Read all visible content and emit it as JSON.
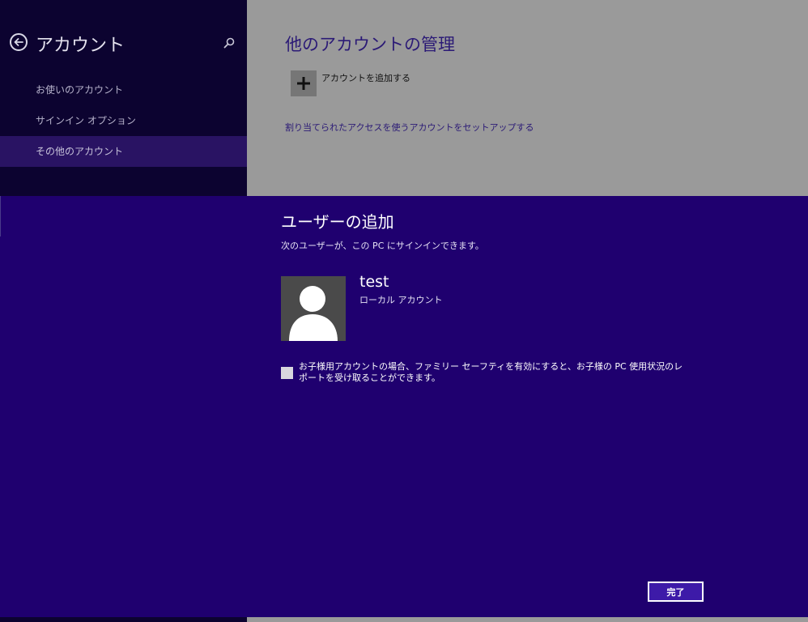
{
  "nav": {
    "title": "アカウント",
    "items": [
      {
        "label": "お使いのアカウント",
        "active": false
      },
      {
        "label": "サインイン オプション",
        "active": false
      },
      {
        "label": "その他のアカウント",
        "active": true
      }
    ]
  },
  "content": {
    "title": "他のアカウントの管理",
    "add_account_label": "アカウントを追加する",
    "assigned_access_link": "割り当てられたアクセスを使うアカウントをセットアップする"
  },
  "dialog": {
    "title": "ユーザーの追加",
    "subtitle": "次のユーザーが、この PC にサインインできます。",
    "user": {
      "name": "test",
      "type": "ローカル アカウント"
    },
    "family_safety_text": "お子様用アカウントの場合、ファミリー セーフティを有効にすると、お子様の PC 使用状況のレポートを受け取ることができます。",
    "family_safety_checked": false,
    "done_label": "完了"
  },
  "icons": {
    "back": "back-arrow-icon",
    "search": "search-icon",
    "add": "plus-icon",
    "avatar": "user-silhouette-icon"
  },
  "colors": {
    "nav_background": "#0c0330",
    "nav_active": "#291363",
    "dialog_background": "#1f006f",
    "accent_text": "#2b1a76",
    "dimmed_background": "#9a9a9a"
  }
}
